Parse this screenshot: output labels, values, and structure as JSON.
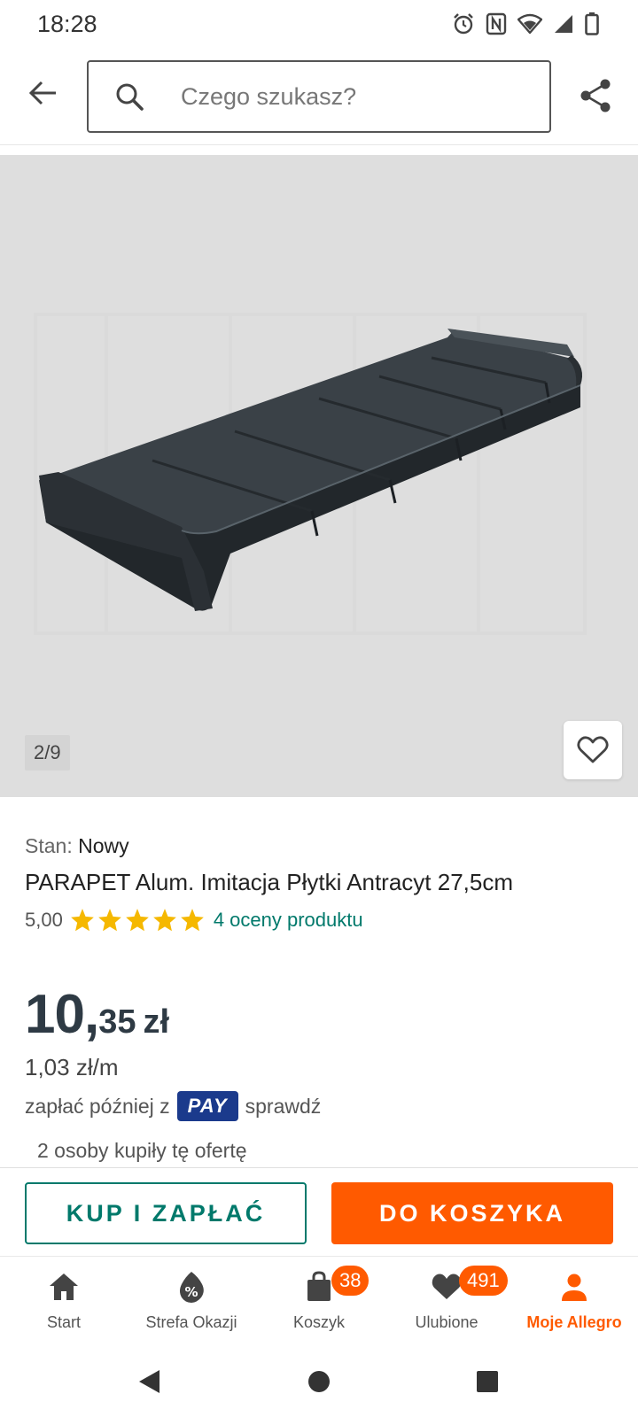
{
  "status_bar": {
    "time": "18:28",
    "icons": [
      "alarm-icon",
      "nfc-icon",
      "wifi-icon",
      "signal-icon",
      "battery-icon"
    ]
  },
  "top_bar": {
    "back_icon": "arrow-left-icon",
    "search": {
      "placeholder": "Czego szukasz?",
      "value": "",
      "icon": "search-icon"
    },
    "share_icon": "share-icon"
  },
  "gallery": {
    "counter": "2/9",
    "favorite_icon": "heart-outline-icon",
    "image_description_icon": "product-photo"
  },
  "product": {
    "condition_label": "Stan:",
    "condition_value": "Nowy",
    "title": "PARAPET Alum. Imitacja Płytki Antracyt 27,5cm",
    "rating_value": "5,00",
    "stars": 5,
    "rating_link": "4 oceny produktu",
    "price_int": "10,",
    "price_dec": "35",
    "price_currency": "zł",
    "unit_price": "1,03 zł/m",
    "pay_prefix": "zapłać później z",
    "pay_badge": "PAY",
    "pay_link": "sprawdź",
    "buyers": "2 osoby kupiły tę ofertę"
  },
  "actions": {
    "buy_now": "KUP I ZAPŁAĆ",
    "add_to_cart": "DO KOSZYKA"
  },
  "bottom_nav": {
    "items": [
      {
        "label": "Start",
        "icon": "home-icon",
        "badge": ""
      },
      {
        "label": "Strefa Okazji",
        "icon": "deals-icon",
        "badge": ""
      },
      {
        "label": "Koszyk",
        "icon": "cart-bag-icon",
        "badge": "38"
      },
      {
        "label": "Ulubione",
        "icon": "heart-icon",
        "badge": "491"
      },
      {
        "label": "Moje Allegro",
        "icon": "user-icon",
        "badge": ""
      }
    ],
    "active": "Moje Allegro"
  },
  "colors": {
    "accent": "#ff5a00",
    "teal": "#00796b",
    "pay_blue": "#1b3a8c",
    "star": "#f5b800",
    "price": "#2e3a44"
  }
}
